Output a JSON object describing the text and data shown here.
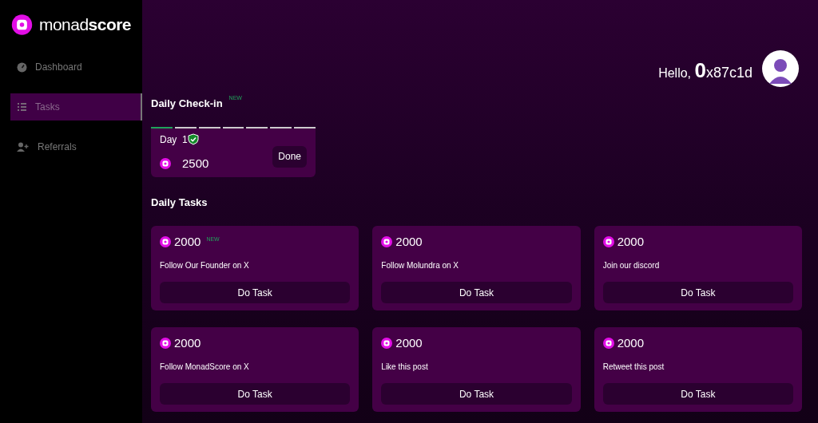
{
  "logo": {
    "text": "monad**score**"
  },
  "sidebar": {
    "items": [
      {
        "label": "Dashboard",
        "kind": "dashboard",
        "selected": false
      },
      {
        "label": "Tasks",
        "kind": "tasks",
        "selected": true
      },
      {
        "label": "Referrals",
        "kind": "referrals",
        "selected": false
      }
    ]
  },
  "header": {
    "greeting": "Hello,",
    "address_first": "0",
    "address_rest": "x87c1d"
  },
  "checkin": {
    "title": "Daily Check-in",
    "badge": "NEW",
    "segments": [
      {
        "done": true
      },
      {
        "done": false
      },
      {
        "done": false
      },
      {
        "done": false
      },
      {
        "done": false
      },
      {
        "done": false
      },
      {
        "done": false
      }
    ],
    "day": "Day  1",
    "verified": true,
    "points": "2500",
    "button": "Done"
  },
  "daily_tasks": {
    "title": "Daily Tasks",
    "tasks": [
      {
        "points": "2000",
        "badge": "NEW",
        "label": "Follow Our Founder on X",
        "button": "Do Task"
      },
      {
        "points": "2000",
        "label": "Follow Molundra on X",
        "button": "Do Task"
      },
      {
        "points": "2000",
        "label": "Join our discord",
        "button": "Do Task"
      },
      {
        "points": "2000",
        "label": "Follow MonadScore on X",
        "button": "Do Task"
      },
      {
        "points": "2000",
        "label": "Like this post",
        "button": "Do Task"
      },
      {
        "points": "2000",
        "label": "Retweet this post",
        "button": "Do Task"
      }
    ]
  }
}
